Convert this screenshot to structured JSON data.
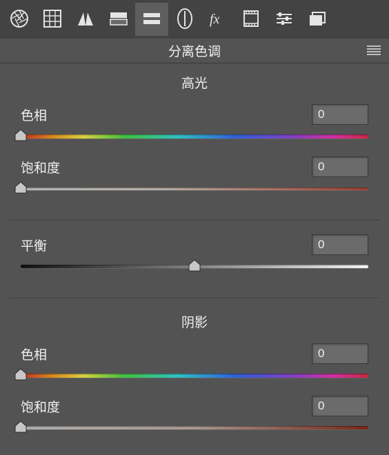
{
  "panel": {
    "title": "分离色调"
  },
  "sections": {
    "highlights": {
      "title": "高光",
      "hue": {
        "label": "色相",
        "value": "0"
      },
      "saturation": {
        "label": "饱和度",
        "value": "0"
      }
    },
    "balance": {
      "label": "平衡",
      "value": "0"
    },
    "shadows": {
      "title": "阴影",
      "hue": {
        "label": "色相",
        "value": "0"
      },
      "saturation": {
        "label": "饱和度",
        "value": "0"
      }
    }
  }
}
